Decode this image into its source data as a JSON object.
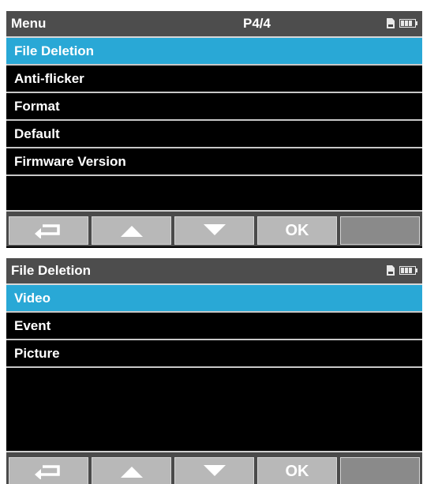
{
  "menu_screen": {
    "header": {
      "title": "Menu",
      "page": "P4/4"
    },
    "items": [
      {
        "label": "File Deletion",
        "selected": true
      },
      {
        "label": "Anti-flicker",
        "selected": false
      },
      {
        "label": "Format",
        "selected": false
      },
      {
        "label": "Default",
        "selected": false
      },
      {
        "label": "Firmware Version",
        "selected": false
      }
    ],
    "toolbar": {
      "back_icon": "return-icon",
      "up_icon": "up-arrow-icon",
      "down_icon": "down-arrow-icon",
      "ok_label": "OK"
    }
  },
  "file_deletion_screen": {
    "header": {
      "title": "File Deletion"
    },
    "items": [
      {
        "label": "Video",
        "selected": true
      },
      {
        "label": "Event",
        "selected": false
      },
      {
        "label": "Picture",
        "selected": false
      }
    ],
    "toolbar": {
      "back_icon": "return-icon",
      "up_icon": "up-arrow-icon",
      "down_icon": "down-arrow-icon",
      "ok_label": "OK"
    }
  },
  "status_icons": [
    "sd-card-icon",
    "battery-icon"
  ],
  "colors": {
    "selected_row": "#29a8d6",
    "header_bg": "#4d4d4d",
    "screen_bg": "#000000",
    "button_bg": "#b8b8b8"
  }
}
